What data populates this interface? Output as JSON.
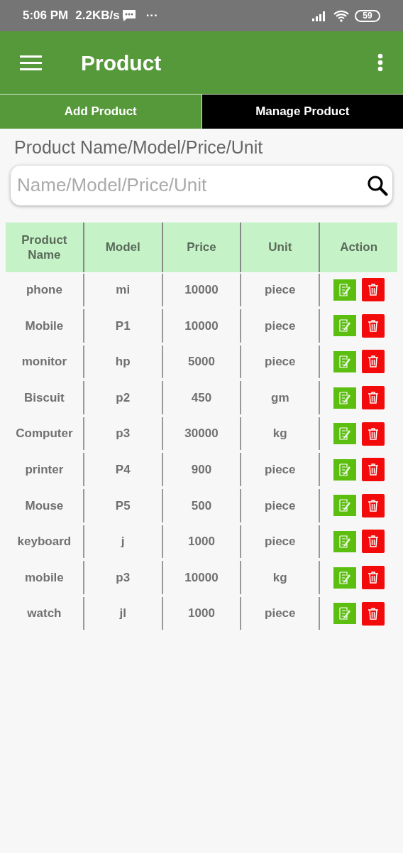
{
  "status_bar": {
    "time": "5:06 PM",
    "speed": "2.2KB/s",
    "more": "···",
    "battery": "59"
  },
  "app_bar": {
    "title": "Product"
  },
  "tabs": [
    {
      "label": "Add Product",
      "selected": false
    },
    {
      "label": "Manage Product",
      "selected": true
    }
  ],
  "search": {
    "label": "Product Name/Model/Price/Unit",
    "placeholder": "Name/Model/Price/Unit"
  },
  "table": {
    "columns": [
      "Product\nName",
      "Model",
      "Price",
      "Unit",
      "Action"
    ],
    "rows": [
      [
        "phone",
        "mi",
        "10000",
        "piece"
      ],
      [
        "Mobile",
        "P1",
        "10000",
        "piece"
      ],
      [
        "monitor",
        "hp",
        "5000",
        "piece"
      ],
      [
        "Biscuit",
        "p2",
        "450",
        "gm"
      ],
      [
        "Computer",
        "p3",
        "30000",
        "kg"
      ],
      [
        "printer",
        "P4",
        "900",
        "piece"
      ],
      [
        "Mouse",
        "P5",
        "500",
        "piece"
      ],
      [
        "keyboard",
        "j",
        "1000",
        "piece"
      ],
      [
        "mobile",
        "p3",
        "10000",
        "kg"
      ],
      [
        "watch",
        "jl",
        "1000",
        "piece"
      ]
    ]
  }
}
